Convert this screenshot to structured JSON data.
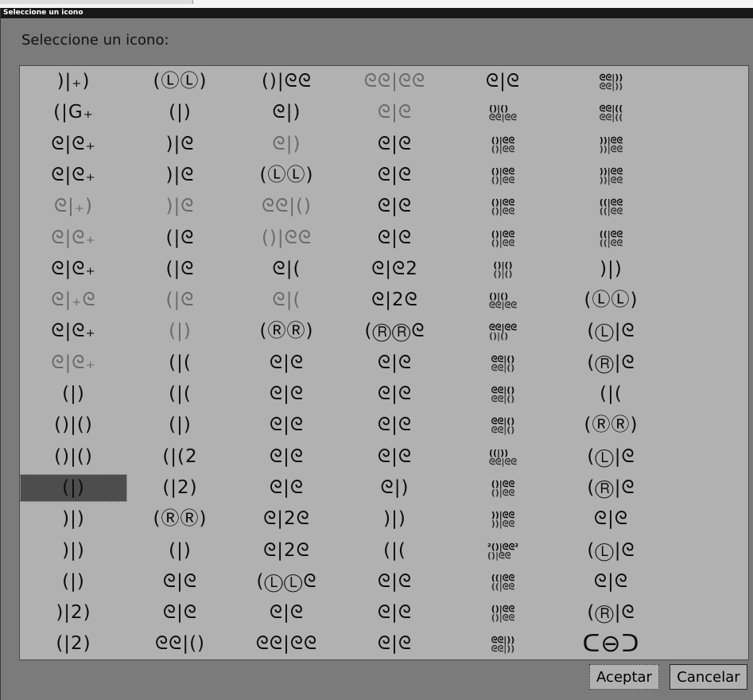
{
  "window": {
    "title": "Seleccione un icono"
  },
  "dialog": {
    "prompt": "Seleccione un icono:",
    "ok_label": "Aceptar",
    "cancel_label": "Cancelar"
  },
  "grid": {
    "columns": 6,
    "rows": 19,
    "selected": {
      "row": 13,
      "col": 0
    },
    "icons": [
      [
        {
          "glyph": ")|₊)",
          "shade": ""
        },
        {
          "glyph": "(ⓁⓁ)",
          "shade": ""
        },
        {
          "glyph": "()|ᘓᘓ",
          "shade": ""
        },
        {
          "glyph": "ᘓᘓ|ᘓᘓ",
          "shade": "dim"
        },
        {
          "glyph": "ᘓ|ᘓ",
          "shade": ""
        },
        {
          "glyph": "ᘓᘓ|))\nᘓᘓ|))",
          "shade": "small"
        }
      ],
      [
        {
          "glyph": "(|G₊",
          "shade": ""
        },
        {
          "glyph": "(|)",
          "shade": ""
        },
        {
          "glyph": "ᘓ|)",
          "shade": ""
        },
        {
          "glyph": "ᘓ|ᘓ",
          "shade": "dim"
        },
        {
          "glyph": "()|()\nᘓᘓ|ᘓᘓ",
          "shade": "small"
        },
        {
          "glyph": "ᘓᘓ|((\nᘓᘓ|((",
          "shade": "small"
        }
      ],
      [
        {
          "glyph": "ᘓ|ᘓ₊",
          "shade": ""
        },
        {
          "glyph": ")|ᘓ",
          "shade": ""
        },
        {
          "glyph": "ᘓ|)",
          "shade": "dim"
        },
        {
          "glyph": "ᘓ|ᘓ",
          "shade": ""
        },
        {
          "glyph": "()|ᘓᘓ\n()|ᘓᘓ",
          "shade": "small"
        },
        {
          "glyph": "))|ᘓᘓ\n))|ᘓᘓ",
          "shade": "small"
        }
      ],
      [
        {
          "glyph": "ᘓ|ᘓ₊",
          "shade": ""
        },
        {
          "glyph": ")|ᘓ",
          "shade": ""
        },
        {
          "glyph": "(ⓁⓁ)",
          "shade": ""
        },
        {
          "glyph": "ᘓ|ᘓ",
          "shade": ""
        },
        {
          "glyph": "()|ᘓᘓ\n()|ᘓᘓ",
          "shade": "small"
        },
        {
          "glyph": "))|ᘓᘓ\n))|ᘓᘓ",
          "shade": "small"
        }
      ],
      [
        {
          "glyph": "ᘓ|₊)",
          "shade": "dim"
        },
        {
          "glyph": ")|ᘓ",
          "shade": "dim"
        },
        {
          "glyph": "ᘓᘓ|()",
          "shade": "dim"
        },
        {
          "glyph": "ᘓ|ᘓ",
          "shade": ""
        },
        {
          "glyph": "()|ᘓᘓ\n()|ᘓᘓ",
          "shade": "small"
        },
        {
          "glyph": "((|ᘓᘓ\n((|ᘓᘓ",
          "shade": "small"
        }
      ],
      [
        {
          "glyph": "ᘓ|ᘓ₊",
          "shade": "dim"
        },
        {
          "glyph": "(|ᘓ",
          "shade": ""
        },
        {
          "glyph": "()|ᘓᘓ",
          "shade": "dim"
        },
        {
          "glyph": "ᘓ|ᘓ",
          "shade": ""
        },
        {
          "glyph": "()|ᘓᘓ\n()|ᘓᘓ",
          "shade": "small"
        },
        {
          "glyph": "((|ᘓᘓ\n((|ᘓᘓ",
          "shade": "small"
        }
      ],
      [
        {
          "glyph": "ᘓ|ᘓ₊",
          "shade": ""
        },
        {
          "glyph": "(|ᘓ",
          "shade": ""
        },
        {
          "glyph": "ᘓ|(",
          "shade": ""
        },
        {
          "glyph": "ᘓ|ᘓ2",
          "shade": ""
        },
        {
          "glyph": "()|()\n()|()",
          "shade": "small"
        },
        {
          "glyph": ")|)",
          "shade": ""
        }
      ],
      [
        {
          "glyph": "ᘓ|₊ᘓ",
          "shade": "dim"
        },
        {
          "glyph": "(|ᘓ",
          "shade": "dim"
        },
        {
          "glyph": "ᘓ|(",
          "shade": "dim"
        },
        {
          "glyph": "ᘓ|2ᘓ",
          "shade": ""
        },
        {
          "glyph": "()|()\nᘓᘓ|ᘓᘓ",
          "shade": "small"
        },
        {
          "glyph": "(ⓁⓁ)",
          "shade": ""
        }
      ],
      [
        {
          "glyph": "ᘓ|ᘓ₊",
          "shade": ""
        },
        {
          "glyph": "(|)",
          "shade": "dim"
        },
        {
          "glyph": "(ⓇⓇ)",
          "shade": ""
        },
        {
          "glyph": "(ⓇⓇᘓ",
          "shade": ""
        },
        {
          "glyph": "ᘓᘓ|ᘓᘓ\n()|()",
          "shade": "small"
        },
        {
          "glyph": "(Ⓛ|ᘓ",
          "shade": ""
        }
      ],
      [
        {
          "glyph": "ᘓ|ᘓ₊",
          "shade": "dim"
        },
        {
          "glyph": "(|(",
          "shade": ""
        },
        {
          "glyph": "ᘓ|ᘓ",
          "shade": ""
        },
        {
          "glyph": "ᘓ|ᘓ",
          "shade": ""
        },
        {
          "glyph": "ᘓᘓ|()\nᘓᘓ|()",
          "shade": "small"
        },
        {
          "glyph": "(Ⓡ|ᘓ",
          "shade": ""
        }
      ],
      [
        {
          "glyph": "(|)",
          "shade": ""
        },
        {
          "glyph": "(|(",
          "shade": ""
        },
        {
          "glyph": "ᘓ|ᘓ",
          "shade": ""
        },
        {
          "glyph": "ᘓ|ᘓ",
          "shade": ""
        },
        {
          "glyph": "ᘓᘓ|()\nᘓᘓ|()",
          "shade": "small"
        },
        {
          "glyph": "(|(",
          "shade": ""
        }
      ],
      [
        {
          "glyph": "()|()",
          "shade": ""
        },
        {
          "glyph": "(|)",
          "shade": ""
        },
        {
          "glyph": "ᘓ|ᘓ",
          "shade": ""
        },
        {
          "glyph": "ᘓ|ᘓ",
          "shade": ""
        },
        {
          "glyph": "ᘓᘓ|()\nᘓᘓ|()",
          "shade": "small"
        },
        {
          "glyph": "(ⓇⓇ)",
          "shade": ""
        }
      ],
      [
        {
          "glyph": "()|()",
          "shade": ""
        },
        {
          "glyph": "(|(2",
          "shade": ""
        },
        {
          "glyph": "ᘓ|ᘓ",
          "shade": ""
        },
        {
          "glyph": "ᘓ|ᘓ",
          "shade": ""
        },
        {
          "glyph": "((|))\nᘓᘓ|ᘓᘓ",
          "shade": "small"
        },
        {
          "glyph": "(Ⓛ|ᘓ",
          "shade": ""
        }
      ],
      [
        {
          "glyph": "(|)",
          "shade": ""
        },
        {
          "glyph": "(|2)",
          "shade": ""
        },
        {
          "glyph": "ᘓ|ᘓ",
          "shade": ""
        },
        {
          "glyph": "ᘓ|)",
          "shade": ""
        },
        {
          "glyph": "()|ᘓᘓ\n()|ᘓᘓ",
          "shade": "small"
        },
        {
          "glyph": "(Ⓡ|ᘓ",
          "shade": ""
        }
      ],
      [
        {
          "glyph": ")|)",
          "shade": ""
        },
        {
          "glyph": "(ⓇⓇ)",
          "shade": ""
        },
        {
          "glyph": "ᘓ|2ᘓ",
          "shade": ""
        },
        {
          "glyph": ")|)",
          "shade": ""
        },
        {
          "glyph": "))|ᘓᘓ\n))|ᘓᘓ",
          "shade": "small"
        },
        {
          "glyph": "ᘓ|ᘓ",
          "shade": ""
        }
      ],
      [
        {
          "glyph": ")|)",
          "shade": ""
        },
        {
          "glyph": "(|)",
          "shade": ""
        },
        {
          "glyph": "ᘓ|2ᘓ",
          "shade": ""
        },
        {
          "glyph": "(|(",
          "shade": ""
        },
        {
          "glyph": "²()|ᘓᘓ²\n()|ᘓᘓ",
          "shade": "small"
        },
        {
          "glyph": "(Ⓛ|ᘓ",
          "shade": ""
        }
      ],
      [
        {
          "glyph": "(|)",
          "shade": ""
        },
        {
          "glyph": "ᘓ|ᘓ",
          "shade": ""
        },
        {
          "glyph": "(ⓁⓁᘓ",
          "shade": ""
        },
        {
          "glyph": "ᘓ|ᘓ",
          "shade": ""
        },
        {
          "glyph": "((|ᘓᘓ\n((|ᘓᘓ",
          "shade": "small"
        },
        {
          "glyph": "ᘓ|ᘓ",
          "shade": ""
        }
      ],
      [
        {
          "glyph": ")|2)",
          "shade": ""
        },
        {
          "glyph": "ᘓ|ᘓ",
          "shade": ""
        },
        {
          "glyph": "ᘓ|ᘓ",
          "shade": ""
        },
        {
          "glyph": "ᘓ|ᘓ",
          "shade": ""
        },
        {
          "glyph": "()|ᘓᘓ\n()|ᘓᘓ",
          "shade": "small"
        },
        {
          "glyph": "(Ⓡ|ᘓ",
          "shade": ""
        }
      ],
      [
        {
          "glyph": "(|2)",
          "shade": ""
        },
        {
          "glyph": "ᘓᘓ|()",
          "shade": ""
        },
        {
          "glyph": "ᘓᘓ|ᘓᘓ",
          "shade": ""
        },
        {
          "glyph": "ᘓ|ᘓ",
          "shade": ""
        },
        {
          "glyph": "ᘓᘓ|))\nᘓᘓ|))",
          "shade": "small"
        },
        {
          "glyph": "ᑕ⊖ᑐ",
          "shade": "big"
        }
      ]
    ]
  }
}
